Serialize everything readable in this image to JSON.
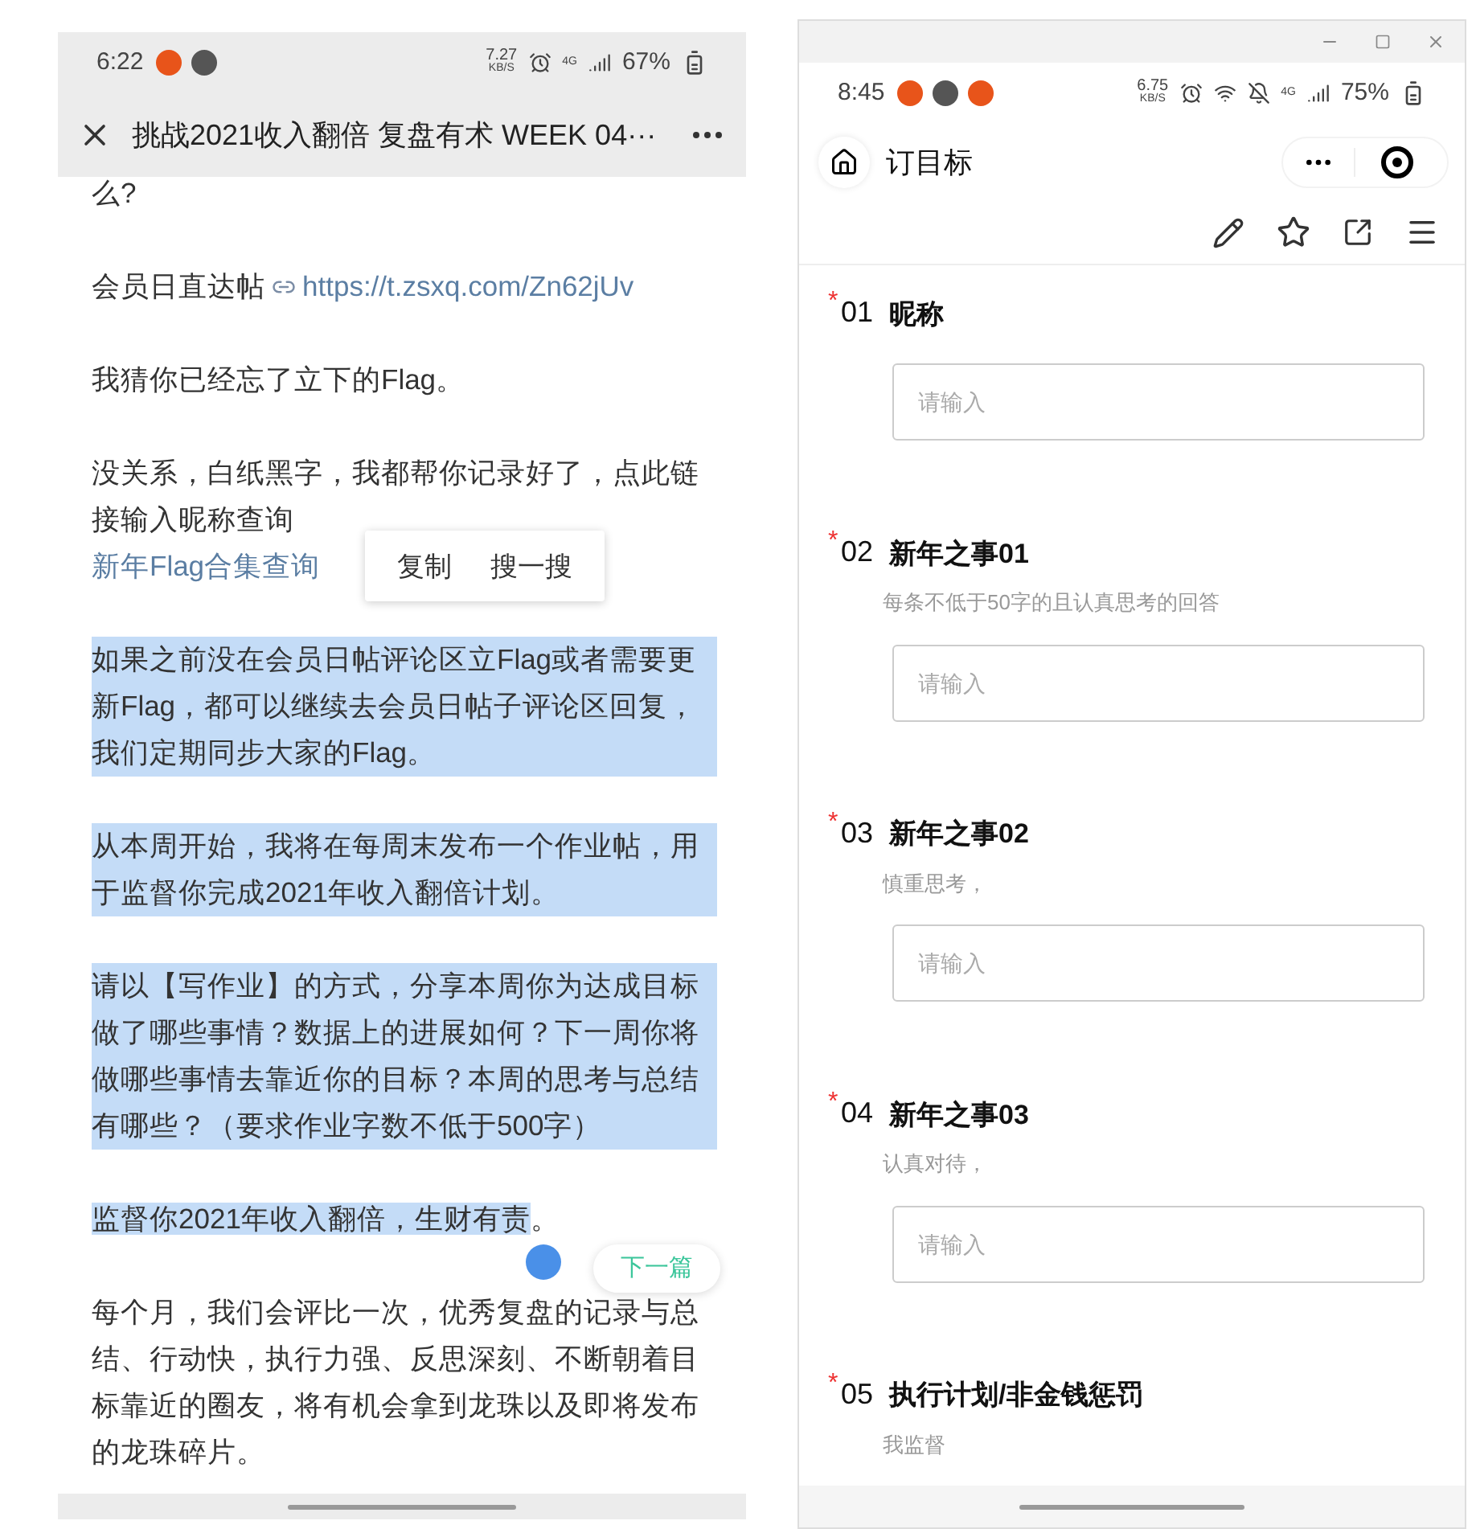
{
  "left_phone": {
    "status_bar": {
      "time": "6:22",
      "net_speed": "7.27",
      "net_unit": "KB/S",
      "network": "4G",
      "battery": "67%"
    },
    "title": "挑战2021收入翻倍 复盘有术 WEEK 04···",
    "paragraphs": [
      {
        "kind": "text",
        "text": "么?",
        "selected": false
      },
      {
        "kind": "url",
        "label": "会员日直达帖",
        "url": "https://t.zsxq.com/Zn62jUv"
      },
      {
        "kind": "text",
        "text": "我猜你已经忘了立下的Flag。",
        "selected": false
      },
      {
        "kind": "text_link",
        "text": "没关系，白纸黑字，我都帮你记录好了，点此链接输入昵称查询",
        "link": "新年Flag合集查询"
      },
      {
        "kind": "text",
        "text": "如果之前没在会员日帖评论区立Flag或者需要更新Flag，都可以继续去会员日帖子评论区回复，我们定期同步大家的Flag。",
        "selected": true
      },
      {
        "kind": "text",
        "text": "从本周开始，我将在每周末发布一个作业帖，用于监督你完成2021年收入翻倍计划。",
        "selected": true
      },
      {
        "kind": "text",
        "text": "请以【写作业】的方式，分享本周你为达成目标做了哪些事情？数据上的进展如何？下一周你将做哪些事情去靠近你的目标？本周的思考与总结有哪些？（要求作业字数不低于500字）",
        "selected": true
      },
      {
        "kind": "split",
        "spans": [
          {
            "text": "监督你2021年收入翻倍，生财有责",
            "selected": true
          },
          {
            "text": "。",
            "selected": false
          }
        ]
      },
      {
        "kind": "text",
        "text": "每个月，我们会评比一次，优秀复盘的记录与总结、行动快，执行力强、反思深刻、不断朝着目标靠近的圈友，将有机会拿到龙珠以及即将发布的龙珠碎片。",
        "selected": false
      }
    ],
    "context_menu": [
      "复制",
      "搜一搜"
    ],
    "next_button": "下一篇"
  },
  "right_window": {
    "status_bar": {
      "time": "8:45",
      "net_speed": "6.75",
      "net_unit": "KB/S",
      "network": "4G",
      "battery": "75%"
    },
    "title": "订目标",
    "questions": [
      {
        "number": "01",
        "title": "昵称",
        "required_mark": "*",
        "placeholder": "请输入"
      },
      {
        "number": "02",
        "title": "新年之事01",
        "required_mark": "*",
        "description": "每条不低于50字的且认真思考的回答",
        "placeholder": "请输入"
      },
      {
        "number": "03",
        "title": "新年之事02",
        "required_mark": "*",
        "description": "慎重思考，",
        "placeholder": "请输入"
      },
      {
        "number": "04",
        "title": "新年之事03",
        "required_mark": "*",
        "description": "认真对待，",
        "placeholder": "请输入"
      },
      {
        "number": "05",
        "title": "执行计划/非金钱惩罚",
        "required_mark": "*",
        "description": "我监督"
      }
    ]
  }
}
